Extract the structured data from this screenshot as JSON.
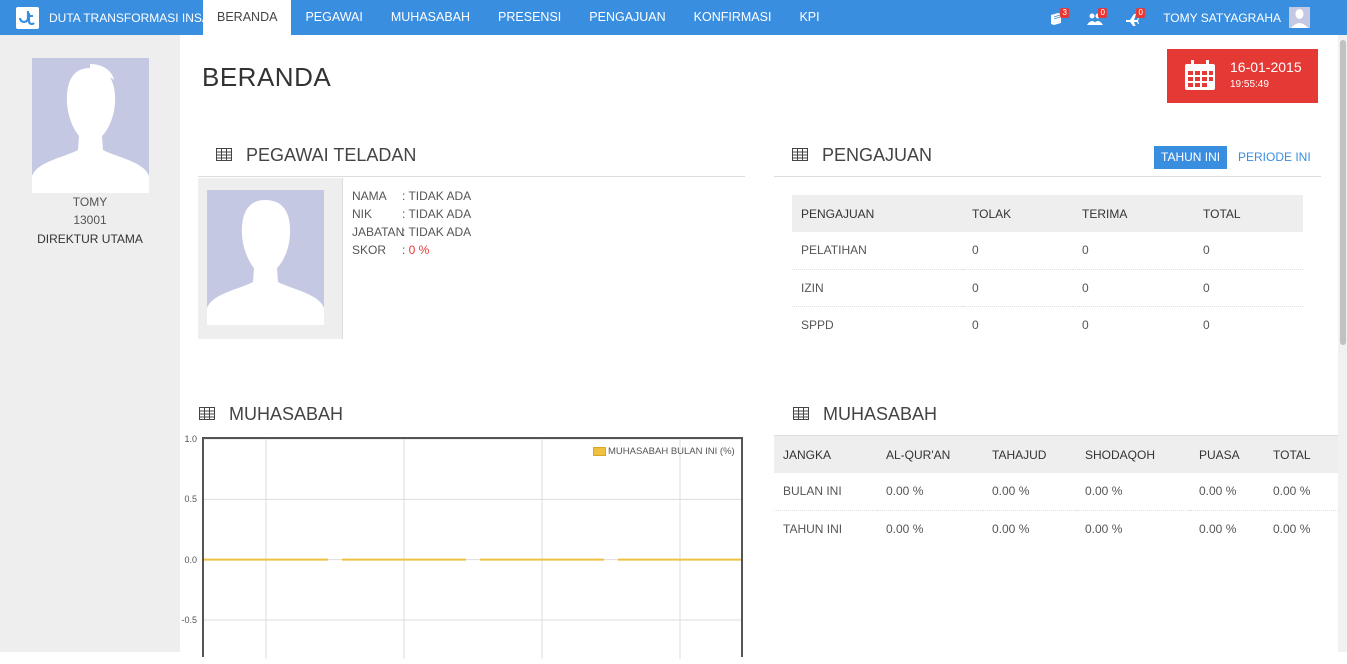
{
  "brand": {
    "name": "DUTA TRANSFORMASI INSANI",
    "logo_text": "dt"
  },
  "nav": {
    "items": [
      {
        "label": "BERANDA",
        "active": true
      },
      {
        "label": "PEGAWAI",
        "active": false
      },
      {
        "label": "MUHASABAH",
        "active": false
      },
      {
        "label": "PRESENSI",
        "active": false
      },
      {
        "label": "PENGAJUAN",
        "active": false
      },
      {
        "label": "KONFIRMASI",
        "active": false
      },
      {
        "label": "KPI",
        "active": false
      }
    ],
    "icons": [
      {
        "name": "book-icon",
        "badge": "3"
      },
      {
        "name": "users-icon",
        "badge": "0"
      },
      {
        "name": "plane-icon",
        "badge": "0"
      }
    ],
    "user_name": "TOMY SATYAGRAHA"
  },
  "sidebar": {
    "name": "TOMY",
    "nik": "13001",
    "position": "DIREKTUR UTAMA"
  },
  "page_title": "BERANDA",
  "date_box": {
    "date": "16-01-2015",
    "time": "19:55:49"
  },
  "pegawai_teladan": {
    "title": "PEGAWAI TELADAN",
    "fields": [
      {
        "key": "NAMA",
        "value": ": TIDAK ADA"
      },
      {
        "key": "NIK",
        "value": ": TIDAK ADA"
      },
      {
        "key": "JABATAN",
        "value": ": TIDAK ADA"
      },
      {
        "key": "SKOR",
        "sep": ": ",
        "value": "0 %"
      }
    ]
  },
  "pengajuan": {
    "title": "PENGAJUAN",
    "tabs": {
      "active": "TAHUN INI",
      "inactive": "PERIODE INI"
    },
    "columns": [
      "PENGAJUAN",
      "TOLAK",
      "TERIMA",
      "TOTAL"
    ],
    "rows": [
      [
        "PELATIHAN",
        "0",
        "0",
        "0"
      ],
      [
        "IZIN",
        "0",
        "0",
        "0"
      ],
      [
        "SPPD",
        "0",
        "0",
        "0"
      ]
    ]
  },
  "muhasabah_chart_title": "MUHASABAH",
  "chart_data": {
    "type": "line",
    "title": "",
    "legend": "MUHASABAH BULAN INI (%)",
    "legend_position": "top-right",
    "yticks": [
      "1.0",
      "0.5",
      "0.0",
      "-0.5"
    ],
    "ylim": [
      -0.7,
      1.0
    ],
    "grid": true,
    "series": [
      {
        "name": "MUHASABAH BULAN INI (%)",
        "color": "#f0c040",
        "values": [
          0,
          0,
          0,
          0
        ]
      }
    ]
  },
  "muhasabah_table": {
    "title": "MUHASABAH",
    "columns": [
      "JANGKA",
      "AL-QUR'AN",
      "TAHAJUD",
      "SHODAQOH",
      "PUASA",
      "TOTAL"
    ],
    "rows": [
      [
        "BULAN INI",
        "0.00 %",
        "0.00 %",
        "0.00 %",
        "0.00 %",
        "0.00 %"
      ],
      [
        "TAHUN INI",
        "0.00 %",
        "0.00 %",
        "0.00 %",
        "0.00 %",
        "0.00 %"
      ]
    ]
  },
  "colors": {
    "primary": "#3a8ee0",
    "danger": "#e53935",
    "avatar_bg": "#c5c8e2",
    "chart_line": "#f0c040"
  }
}
